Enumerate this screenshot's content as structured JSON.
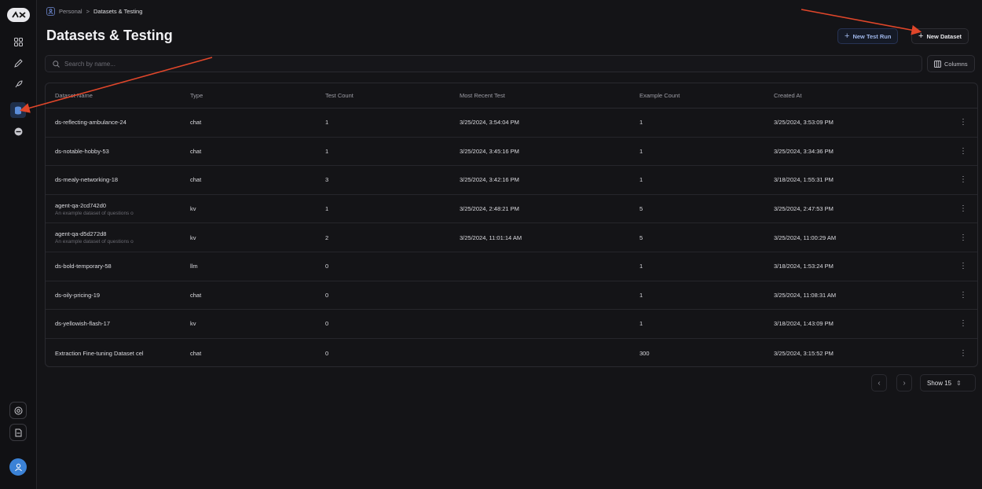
{
  "sidebar": {
    "logo": "L",
    "icons": [
      "grid-icon",
      "pen-icon",
      "rocket-icon",
      "database-icon",
      "circle-minus-icon"
    ],
    "bottom_icons": [
      "settings-icon",
      "document-icon"
    ],
    "avatar_icon": "user-icon"
  },
  "breadcrumb": {
    "root": "Personal",
    "separator": ">",
    "current": "Datasets & Testing"
  },
  "header": {
    "title": "Datasets & Testing",
    "new_test_run": "New Test Run",
    "new_dataset": "New Dataset"
  },
  "search": {
    "placeholder": "Search by name..."
  },
  "columns_button": "Columns",
  "table": {
    "headers": [
      "Dataset Name",
      "Type",
      "Test Count",
      "Most Recent Test",
      "Example Count",
      "Created At"
    ],
    "rows": [
      {
        "name": "ds-reflecting-ambulance-24",
        "desc": "",
        "type": "chat",
        "test_count": "1",
        "most_recent": "3/25/2024, 3:54:04 PM",
        "example_count": "1",
        "created_at": "3/25/2024, 3:53:09 PM"
      },
      {
        "name": "ds-notable-hobby-53",
        "desc": "",
        "type": "chat",
        "test_count": "1",
        "most_recent": "3/25/2024, 3:45:16 PM",
        "example_count": "1",
        "created_at": "3/25/2024, 3:34:36 PM"
      },
      {
        "name": "ds-mealy-networking-18",
        "desc": "",
        "type": "chat",
        "test_count": "3",
        "most_recent": "3/25/2024, 3:42:16 PM",
        "example_count": "1",
        "created_at": "3/18/2024, 1:55:31 PM"
      },
      {
        "name": "agent-qa-2cd742d0",
        "desc": "An example dataset of questions o",
        "type": "kv",
        "test_count": "1",
        "most_recent": "3/25/2024, 2:48:21 PM",
        "example_count": "5",
        "created_at": "3/25/2024, 2:47:53 PM"
      },
      {
        "name": "agent-qa-d5d272d8",
        "desc": "An example dataset of questions o",
        "type": "kv",
        "test_count": "2",
        "most_recent": "3/25/2024, 11:01:14 AM",
        "example_count": "5",
        "created_at": "3/25/2024, 11:00:29 AM"
      },
      {
        "name": "ds-bold-temporary-58",
        "desc": "",
        "type": "llm",
        "test_count": "0",
        "most_recent": "",
        "example_count": "1",
        "created_at": "3/18/2024, 1:53:24 PM"
      },
      {
        "name": "ds-oily-pricing-19",
        "desc": "",
        "type": "chat",
        "test_count": "0",
        "most_recent": "",
        "example_count": "1",
        "created_at": "3/25/2024, 11:08:31 AM"
      },
      {
        "name": "ds-yellowish-flash-17",
        "desc": "",
        "type": "kv",
        "test_count": "0",
        "most_recent": "",
        "example_count": "1",
        "created_at": "3/18/2024, 1:43:09 PM"
      },
      {
        "name": "Extraction Fine-tuning Dataset cel",
        "desc": "",
        "type": "chat",
        "test_count": "0",
        "most_recent": "",
        "example_count": "300",
        "created_at": "3/25/2024, 3:15:52 PM"
      }
    ],
    "row_menu_icon": "more-vertical-icon"
  },
  "pagination": {
    "prev_icon": "chevron-left-icon",
    "next_icon": "chevron-right-icon",
    "show_label": "Show 15"
  },
  "colors": {
    "background": "#141417",
    "accent": "#3b82d6",
    "annotation_arrow": "#e0462a"
  }
}
